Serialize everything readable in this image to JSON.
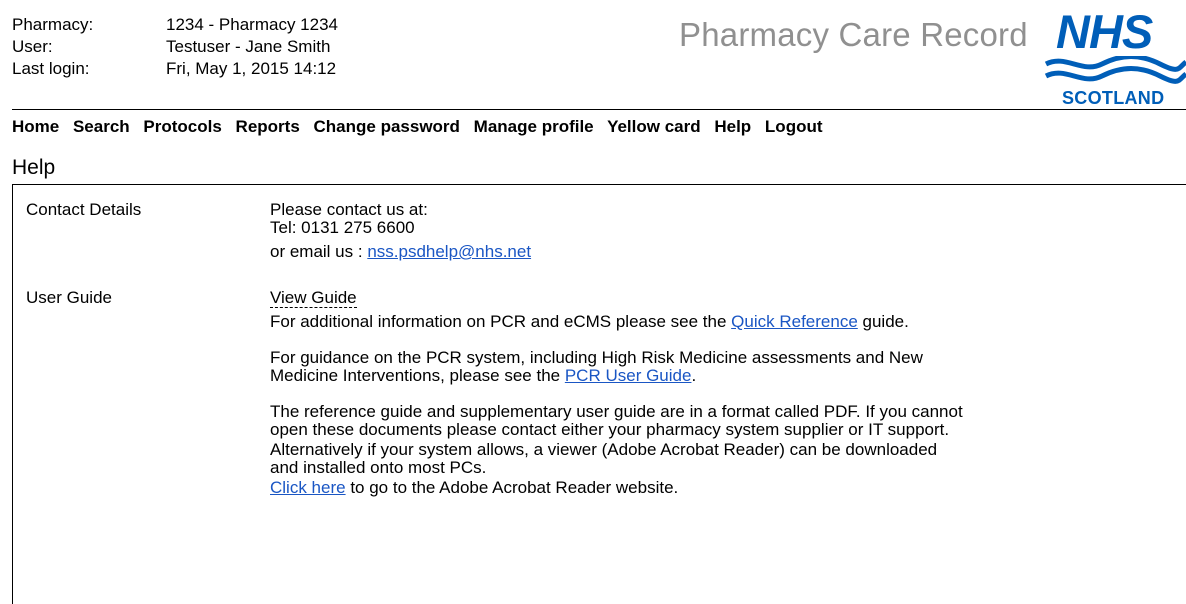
{
  "header": {
    "pharmacy_label": "Pharmacy:",
    "pharmacy_value": "1234 - Pharmacy 1234",
    "user_label": "User:",
    "user_value": "Testuser - Jane Smith",
    "last_login_label": "Last login:",
    "last_login_value": "Fri, May 1, 2015 14:12",
    "app_title": "Pharmacy Care Record",
    "logo_main": "NHS",
    "logo_sub": "SCOTLAND"
  },
  "nav": [
    "Home",
    "Search",
    "Protocols",
    "Reports",
    "Change password",
    "Manage profile",
    "Yellow card",
    "Help",
    "Logout"
  ],
  "page_title": "Help",
  "contact": {
    "label": "Contact Details",
    "line1": "Please contact us at:",
    "line2": "Tel: 0131 275 6600",
    "email_prefix": "or email us : ",
    "email": "nss.psdhelp@nhs.net"
  },
  "guide": {
    "label": "User Guide",
    "view_guide": "View Guide",
    "p1_text": "For additional information on PCR and eCMS please see the ",
    "p1_link": "Quick Reference",
    "p1_end": " guide.",
    "p2_text": "For guidance on the PCR system, including High Risk Medicine assessments and New Medicine Interventions, please see the ",
    "p2_link": "PCR User Guide",
    "p2_end": ".",
    "p3": "The reference guide and supplementary user guide are in a format called PDF. If you cannot open these documents please contact either your pharmacy system supplier or IT support.",
    "p4": "Alternatively if your system allows, a viewer (Adobe Acrobat Reader) can be downloaded and installed onto most PCs.",
    "p5_link": "Click here",
    "p5_text": " to go to the Adobe Acrobat Reader website."
  },
  "colors": {
    "link": "#1a56c4",
    "nhs_blue": "#005eb8",
    "title_grey": "#909090"
  }
}
